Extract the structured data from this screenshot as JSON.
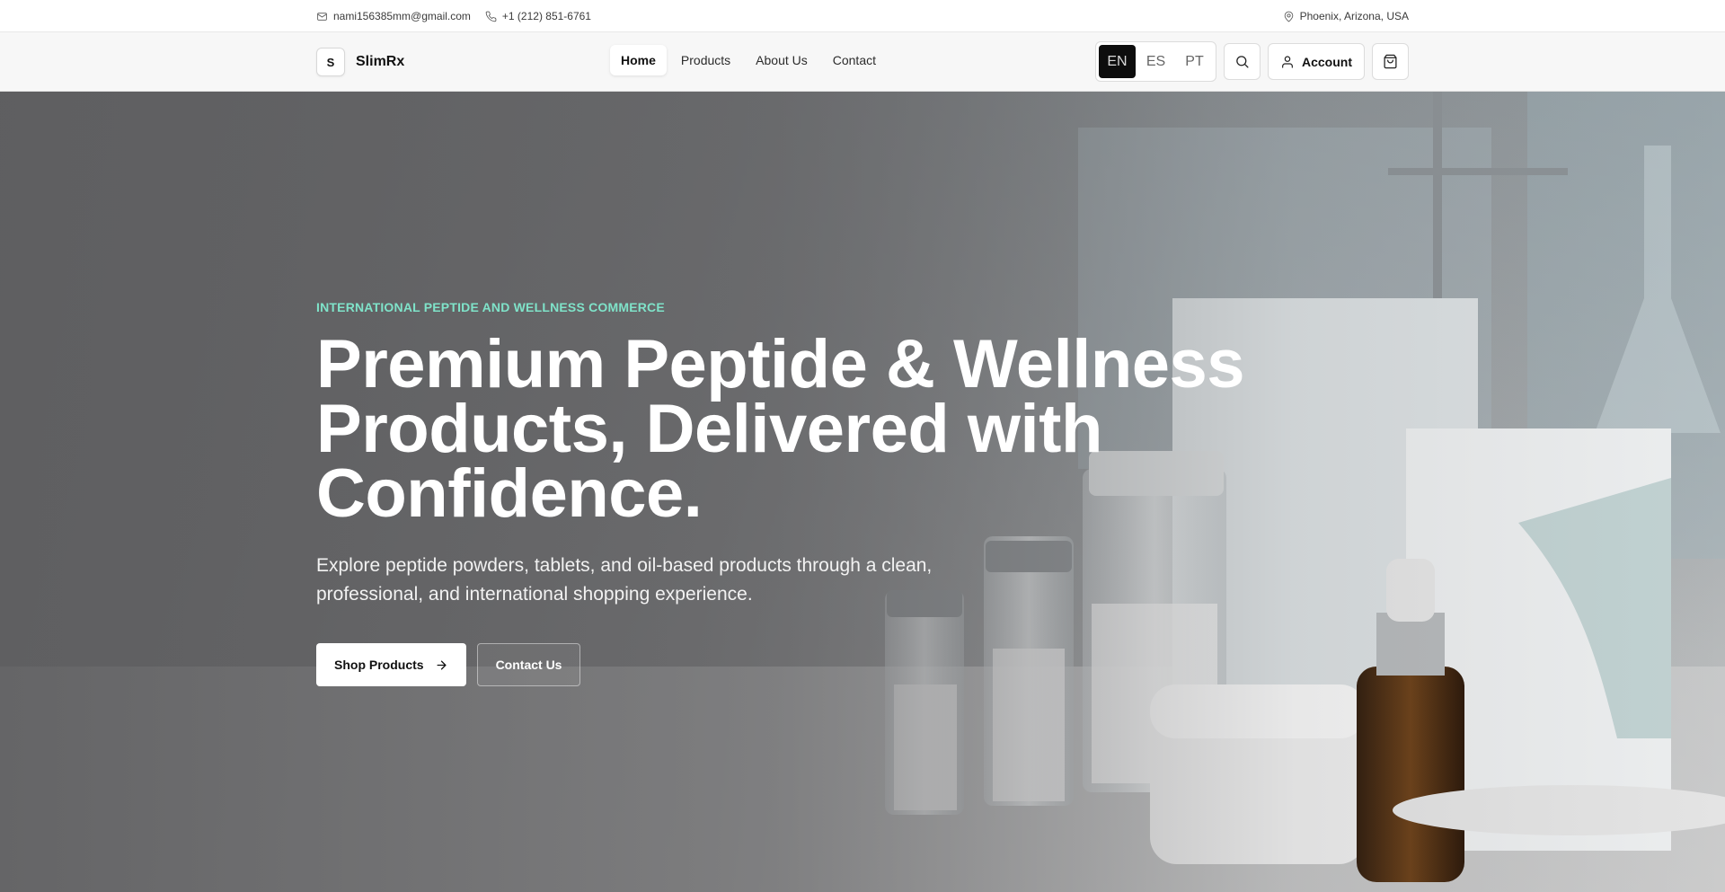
{
  "topbar": {
    "email": "nami156385mm@gmail.com",
    "phone": "+1 (212) 851-6761",
    "location": "Phoenix, Arizona, USA"
  },
  "header": {
    "brand_mark": "S",
    "brand_name": "SlimRx",
    "nav": [
      {
        "label": "Home",
        "active": true
      },
      {
        "label": "Products",
        "active": false
      },
      {
        "label": "About Us",
        "active": false
      },
      {
        "label": "Contact",
        "active": false
      }
    ],
    "languages": [
      {
        "label": "EN",
        "active": true
      },
      {
        "label": "ES",
        "active": false
      },
      {
        "label": "PT",
        "active": false
      }
    ],
    "account_label": "Account",
    "icons": {
      "search": "search-icon",
      "account": "user-icon",
      "cart": "shopping-bag-icon"
    }
  },
  "hero": {
    "eyebrow": "INTERNATIONAL PEPTIDE AND WELLNESS COMMERCE",
    "title": "Premium Peptide & Wellness Products, Delivered with Confidence.",
    "description": "Explore peptide powders, tablets, and oil-based products through a clean, professional, and international shopping experience.",
    "primary_cta": "Shop Products",
    "secondary_cta": "Contact Us"
  },
  "colors": {
    "eyebrow": "#7fe3c9",
    "lang_active_bg": "#0d0d0d",
    "hero_overlay": "#606062"
  }
}
